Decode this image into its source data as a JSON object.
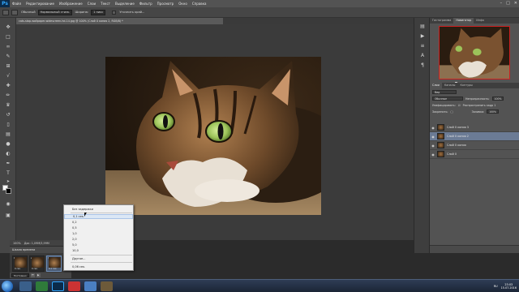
{
  "app": {
    "logo": "Ps"
  },
  "menu": [
    "Файл",
    "Редактирование",
    "Изображение",
    "Слои",
    "Текст",
    "Выделение",
    "Фильтр",
    "Просмотр",
    "Окно",
    "Справка"
  ],
  "options": {
    "style_label": "Обычный",
    "mode_value": "Нормальный стиль",
    "size_label": "Ширина:",
    "size_value": "1 пикс",
    "antialias_label": "Уточнить край..."
  },
  "document": {
    "tab_title": "cats-stop-wallpaper-widescreen-hd-14.jpg @ 100% (Слой 0 копия 2, RGB/8) *"
  },
  "status": {
    "zoom": "100%",
    "doc_size": "Док: 1,09M/3,99M"
  },
  "timeline": {
    "title": "Шкала времени",
    "frames": [
      {
        "number": "1",
        "delay": "0 сек."
      },
      {
        "number": "2",
        "delay": "0 сек."
      },
      {
        "number": "3",
        "delay": "0,1 сек."
      }
    ],
    "loop_value": "Постоянно"
  },
  "delay_menu": {
    "items": [
      "Без задержки",
      "0,1 сек.",
      "0,2",
      "0,5",
      "1,0",
      "2,0",
      "5,0",
      "10,0",
      "Другое...",
      "0,06 сек."
    ],
    "highlighted_index": 1
  },
  "panels": {
    "top_tabs": [
      "Гистограмма",
      "Навигатор",
      "Инфо"
    ],
    "active_top_tab": "Навигатор",
    "nav_zoom": "100%",
    "layer_tabs": [
      "Слои",
      "Каналы",
      "Контуры"
    ],
    "kind_filter": "Вид",
    "blend_mode": "Обычные",
    "opacity_label": "Непрозрачность:",
    "opacity_value": "100%",
    "lock_label": "Закрепить:",
    "fill_label": "Заливка:",
    "fill_value": "100%",
    "propagate_label": "Распространить кадр 1",
    "unify_label": "Унифицировать:",
    "layers": [
      {
        "name": "Слой 0 копия 3",
        "selected": false
      },
      {
        "name": "Слой 0 копия 2",
        "selected": true
      },
      {
        "name": "Слой 0 копия",
        "selected": false
      },
      {
        "name": "Слой 0",
        "selected": false
      }
    ]
  },
  "taskbar": {
    "lang": "RU",
    "time": "23:03",
    "date": "15.07.2016"
  },
  "colors": {
    "foreground": "#ffffff",
    "background": "#000000",
    "selection": "#6b7b95",
    "nav_frame": "#cc2020"
  }
}
